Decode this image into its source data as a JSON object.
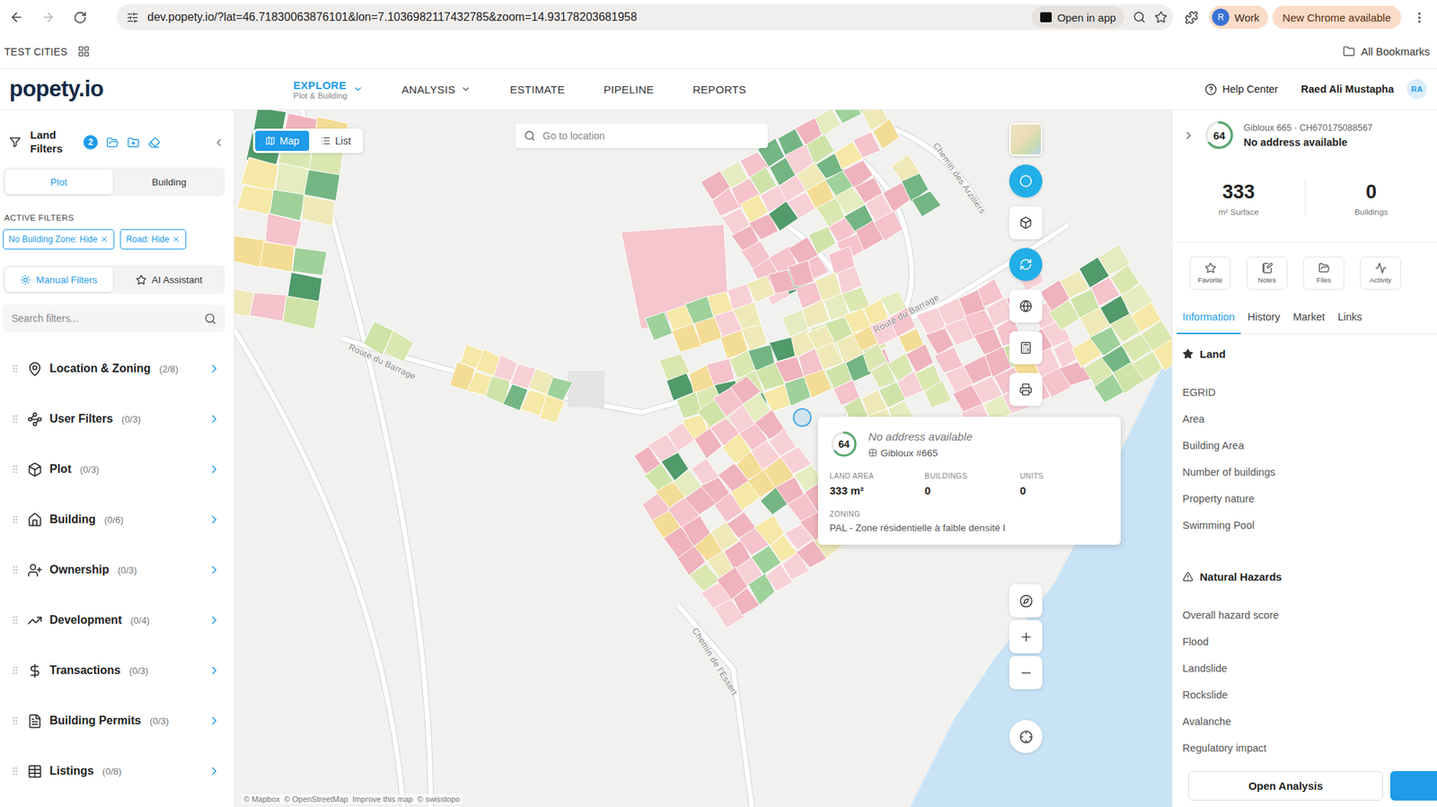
{
  "browser": {
    "url": "dev.popety.io/?lat=46.71830063876101&lon=7.1036982117432785&zoom=14.93178203681958",
    "forward_disabled": true,
    "open_in_app": "Open in app",
    "profile": {
      "initial": "R",
      "label": "Work"
    },
    "update": "New Chrome available"
  },
  "bookmarks": {
    "items": [
      "TEST CITIES"
    ],
    "all": "All Bookmarks"
  },
  "header": {
    "logo": "popety.io",
    "nav": [
      {
        "label": "EXPLORE",
        "sub": "Plot & Building",
        "dropdown": true,
        "selected": true
      },
      {
        "label": "ANALYSIS",
        "dropdown": true,
        "selected": false
      },
      {
        "label": "ESTIMATE",
        "dropdown": false,
        "selected": false
      },
      {
        "label": "PIPELINE",
        "dropdown": false,
        "selected": false
      },
      {
        "label": "REPORTS",
        "dropdown": false,
        "selected": false
      }
    ],
    "help": "Help Center",
    "user": "Raed Ali Mustapha",
    "avatar": "RA"
  },
  "sidebar": {
    "title": "Land Filters",
    "badge": "2",
    "mode_tabs": [
      {
        "label": "Plot",
        "selected": true
      },
      {
        "label": "Building",
        "selected": false
      }
    ],
    "active_filters_label": "ACTIVE FILTERS",
    "active_filters": [
      {
        "label": "No Building Zone: Hide"
      },
      {
        "label": "Road: Hide"
      }
    ],
    "filter_tabs": [
      {
        "label": "Manual Filters",
        "selected": true
      },
      {
        "label": "AI Assistant",
        "selected": false
      }
    ],
    "search_placeholder": "Search filters...",
    "groups": [
      {
        "label": "Location & Zoning",
        "count": "(2/8)"
      },
      {
        "label": "User Filters",
        "count": "(0/3)"
      },
      {
        "label": "Plot",
        "count": "(0/3)"
      },
      {
        "label": "Building",
        "count": "(0/6)"
      },
      {
        "label": "Ownership",
        "count": "(0/3)"
      },
      {
        "label": "Development",
        "count": "(0/4)"
      },
      {
        "label": "Transactions",
        "count": "(0/3)"
      },
      {
        "label": "Building Permits",
        "count": "(0/3)"
      },
      {
        "label": "Listings",
        "count": "(0/8)"
      }
    ]
  },
  "map": {
    "view_tabs": [
      {
        "label": "Map",
        "selected": true
      },
      {
        "label": "List",
        "selected": false
      }
    ],
    "search_placeholder": "Go to location",
    "labels": [
      {
        "text": "Chemin des Arziliers"
      },
      {
        "text": "Route du Barrage"
      },
      {
        "text": "Route du Barrage"
      },
      {
        "text": "Chemin de l'Essert"
      }
    ],
    "tools": [
      {
        "kind": "thumbnail",
        "selected": false
      },
      {
        "kind": "button",
        "selected": true
      },
      {
        "kind": "button",
        "selected": false
      },
      {
        "kind": "button",
        "selected": true
      },
      {
        "kind": "button",
        "selected": false
      },
      {
        "kind": "button",
        "selected": false
      },
      {
        "kind": "button",
        "selected": false
      }
    ],
    "popup": {
      "score": "64",
      "level": 0.64,
      "address": "No address available",
      "parcel": "Gibloux #665",
      "stats": [
        {
          "label": "LAND AREA",
          "value": "333 m²"
        },
        {
          "label": "BUILDINGS",
          "value": "0"
        },
        {
          "label": "UNITS",
          "value": "0"
        }
      ],
      "zoning_label": "ZONING",
      "zoning": "PAL - Zone résidentielle à faible densité I"
    },
    "attribution": [
      "© Mapbox",
      "© OpenStreetMap",
      "Improve this map",
      "© swisstopo"
    ]
  },
  "panel": {
    "ref": "Gibloux 665 · CH670175088567",
    "score": "64",
    "level": 0.64,
    "address": "No address available",
    "stats": [
      {
        "value": "333",
        "label": "m² Surface"
      },
      {
        "value": "0",
        "label": "Buildings"
      }
    ],
    "actions": [
      "Favorite",
      "Notes",
      "Files",
      "Activity"
    ],
    "tabs": [
      {
        "label": "Information",
        "selected": true
      },
      {
        "label": "History",
        "selected": false
      },
      {
        "label": "Market",
        "selected": false
      },
      {
        "label": "Links",
        "selected": false
      }
    ],
    "sections": [
      {
        "title": "Land",
        "rows": [
          "EGRID",
          "Area",
          "Building Area",
          "Number of buildings",
          "Property nature",
          "Swimming Pool"
        ]
      },
      {
        "title": "Natural Hazards",
        "rows": [
          "Overall hazard score",
          "Flood",
          "Landslide",
          "Rockslide",
          "Avalanche",
          "Regulatory impact"
        ]
      }
    ],
    "button": "Open Analysis"
  }
}
